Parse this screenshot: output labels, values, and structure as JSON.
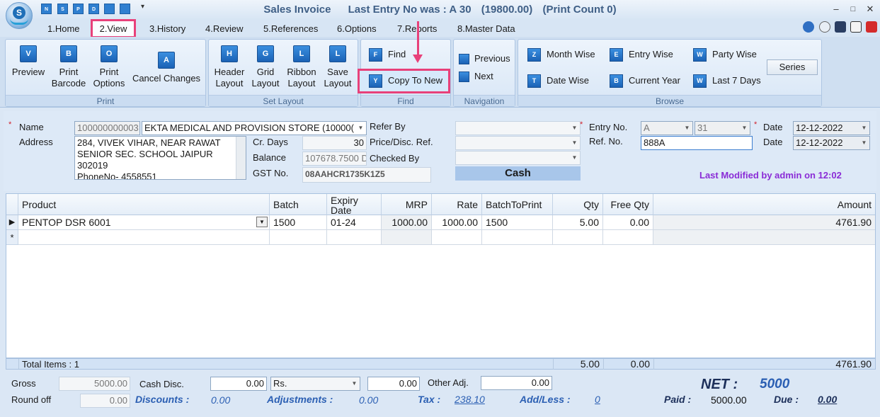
{
  "window": {
    "title": "Sales Invoice",
    "last_entry": "Last Entry No was : A 30",
    "amount": "(19800.00)",
    "print_count": "(Print Count 0)",
    "minimize": "‒",
    "maximize": "□",
    "close": "✕"
  },
  "quick_access": [
    "N",
    "S",
    "P",
    "D",
    "",
    ""
  ],
  "tabs": [
    "1.Home",
    "2.View",
    "3.History",
    "4.Review",
    "5.References",
    "6.Options",
    "7.Reports",
    "8.Master Data"
  ],
  "ribbon": {
    "print": {
      "title": "Print",
      "preview": "Preview",
      "print_barcode": [
        "Print",
        "Barcode"
      ],
      "print_options": [
        "Print",
        "Options"
      ],
      "cancel_changes": "Cancel Changes"
    },
    "set_layout": {
      "title": "Set Layout",
      "header_layout": [
        "Header",
        "Layout"
      ],
      "grid_layout": [
        "Grid",
        "Layout"
      ],
      "ribbon_layout": [
        "Ribbon",
        "Layout"
      ],
      "save_layout": [
        "Save",
        "Layout"
      ]
    },
    "find": {
      "title": "Find",
      "find": "Find",
      "copy_to_new": "Copy To New"
    },
    "navigation": {
      "title": "Navigation",
      "previous": "Previous",
      "next": "Next"
    },
    "browse": {
      "title": "Browse",
      "month_wise": "Month Wise",
      "entry_wise": "Entry Wise",
      "party_wise": "Party Wise",
      "date_wise": "Date Wise",
      "current_year": "Current Year",
      "last_7_days": "Last 7 Days",
      "series": "Series"
    }
  },
  "header": {
    "name_label": "Name",
    "name_code": "100000000003",
    "name_value": "EKTA MEDICAL AND PROVISION STORE (10000(",
    "address_label": "Address",
    "address_lines": [
      "284, VIVEK VIHAR, NEAR RAWAT",
      "SENIOR  SEC. SCHOOL JAIPUR",
      "302019",
      " PhoneNo- 4558551"
    ],
    "cr_days_label": "Cr. Days",
    "cr_days": "30",
    "balance_label": "Balance",
    "balance": "107678.7500 D",
    "gst_label": "GST No.",
    "gst": "08AAHCR1735K1Z5",
    "refer_by_label": "Refer By",
    "price_disc_label": "Price/Disc. Ref.",
    "checked_by_label": "Checked By",
    "cash_label": "Cash",
    "entry_no_label": "Entry No.",
    "entry_series": "A",
    "entry_no": "31",
    "ref_no_label": "Ref. No.",
    "ref_no": "888A",
    "date_label": "Date",
    "date1": "12-12-2022",
    "date2": "12-12-2022",
    "last_modified": "Last Modified by admin on 12:02"
  },
  "grid": {
    "headers": [
      "Product",
      "Batch",
      "Expiry Date",
      "MRP",
      "Rate",
      "BatchToPrint",
      "Qty",
      "Free Qty",
      "Amount"
    ],
    "rows": [
      {
        "product": "PENTOP DSR 6001",
        "batch": "1500",
        "expiry": "01-24",
        "mrp": "1000.00",
        "rate": "1000.00",
        "batch_to_print": "1500",
        "qty": "5.00",
        "free_qty": "0.00",
        "amount": "4761.90"
      }
    ],
    "new_row_marker": "*",
    "current_row_marker": "▶",
    "total_items": "Total Items : 1",
    "total_qty": "5.00",
    "total_free": "0.00",
    "total_amount": "4761.90"
  },
  "footer": {
    "gross_label": "Gross",
    "gross": "5000.00",
    "round_off_label": "Round off",
    "round_off": "0.00",
    "cash_disc_label": "Cash Disc.",
    "cash_disc": "0.00",
    "cash_disc_type": "Rs.",
    "cash_disc_amount": "0.00",
    "other_adj_label": "Other Adj.",
    "other_adj": "0.00",
    "discounts_label": "Discounts :",
    "discounts": "0.00",
    "adjustments_label": "Adjustments :",
    "adjustments": "0.00",
    "tax_label": "Tax :",
    "tax": "238.10",
    "addless_label": "Add/Less :",
    "addless": "0",
    "net_label": "NET :",
    "net": "5000",
    "paid_label": "Paid :",
    "paid": "5000.00",
    "due_label": "Due :",
    "due": "0.00"
  },
  "colors": {
    "highlight": "#e8417a",
    "ribbon_blue": "#1b62b5",
    "title_text": "#3f5f86",
    "last_modified": "#8a2bd6",
    "footer_blue": "#2b5fb3"
  }
}
